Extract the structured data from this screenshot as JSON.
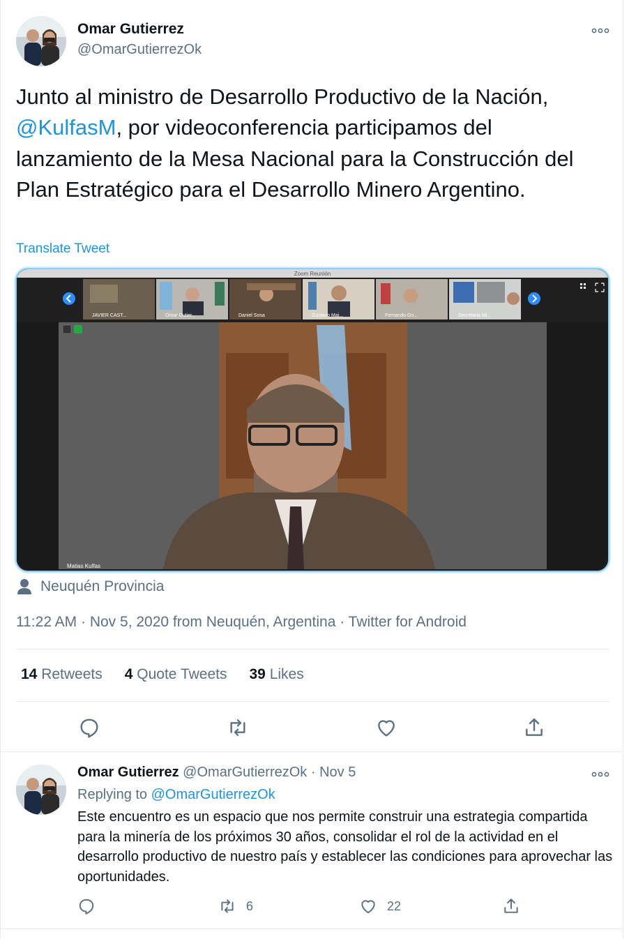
{
  "main_tweet": {
    "author_name": "Omar Gutierrez",
    "author_handle": "@OmarGutierrezOk",
    "text_before_mention": "Junto al ministro de Desarrollo Productivo de la Nación, ",
    "mention": "@KulfasM",
    "text_after_mention": ", por videoconferencia participamos del lanzamiento de la Mesa Nacional para la Construcción del Plan Estratégico para el Desarrollo Minero Argentino.",
    "translate_label": "Translate Tweet",
    "media": {
      "window_title": "Zoom Reunión",
      "participants": [
        "JAVIER CAST...",
        "Omar Gutier...",
        "Daniel Sosa",
        "Gustavo Mai...",
        "Fernando Go...",
        "Secretaria Mi..."
      ],
      "speaker_name": "Matias Kulfas"
    },
    "location": "Neuquén Provincia",
    "meta": "11:22 AM · Nov 5, 2020 from Neuquén, Argentina · Twitter for Android",
    "stats": {
      "retweets_count": "14",
      "retweets_label": "Retweets",
      "quotes_count": "4",
      "quotes_label": "Quote Tweets",
      "likes_count": "39",
      "likes_label": "Likes"
    }
  },
  "reply_tweet": {
    "author_name": "Omar Gutierrez",
    "author_handle": "@OmarGutierrezOk",
    "separator": "·",
    "date": "Nov 5",
    "replying_label": "Replying to",
    "replying_to": "@OmarGutierrezOk",
    "text": "Este encuentro es un espacio que nos permite construir una estrategia compartida para la minería de los próximos 30 años, consolidar el rol de la actividad en el desarrollo productivo de nuestro país y establecer las condiciones para aprovechar las oportunidades.",
    "retweets": "6",
    "likes": "22"
  },
  "more_label": "∘∘∘",
  "colors": {
    "accent": "#1b95e0",
    "secondary_text": "#5b7083",
    "primary_text": "#0f1419",
    "divider": "#e6ecf0"
  },
  "icons": [
    "more-icon",
    "person-location-icon",
    "reply-icon",
    "retweet-icon",
    "like-icon",
    "share-icon"
  ]
}
